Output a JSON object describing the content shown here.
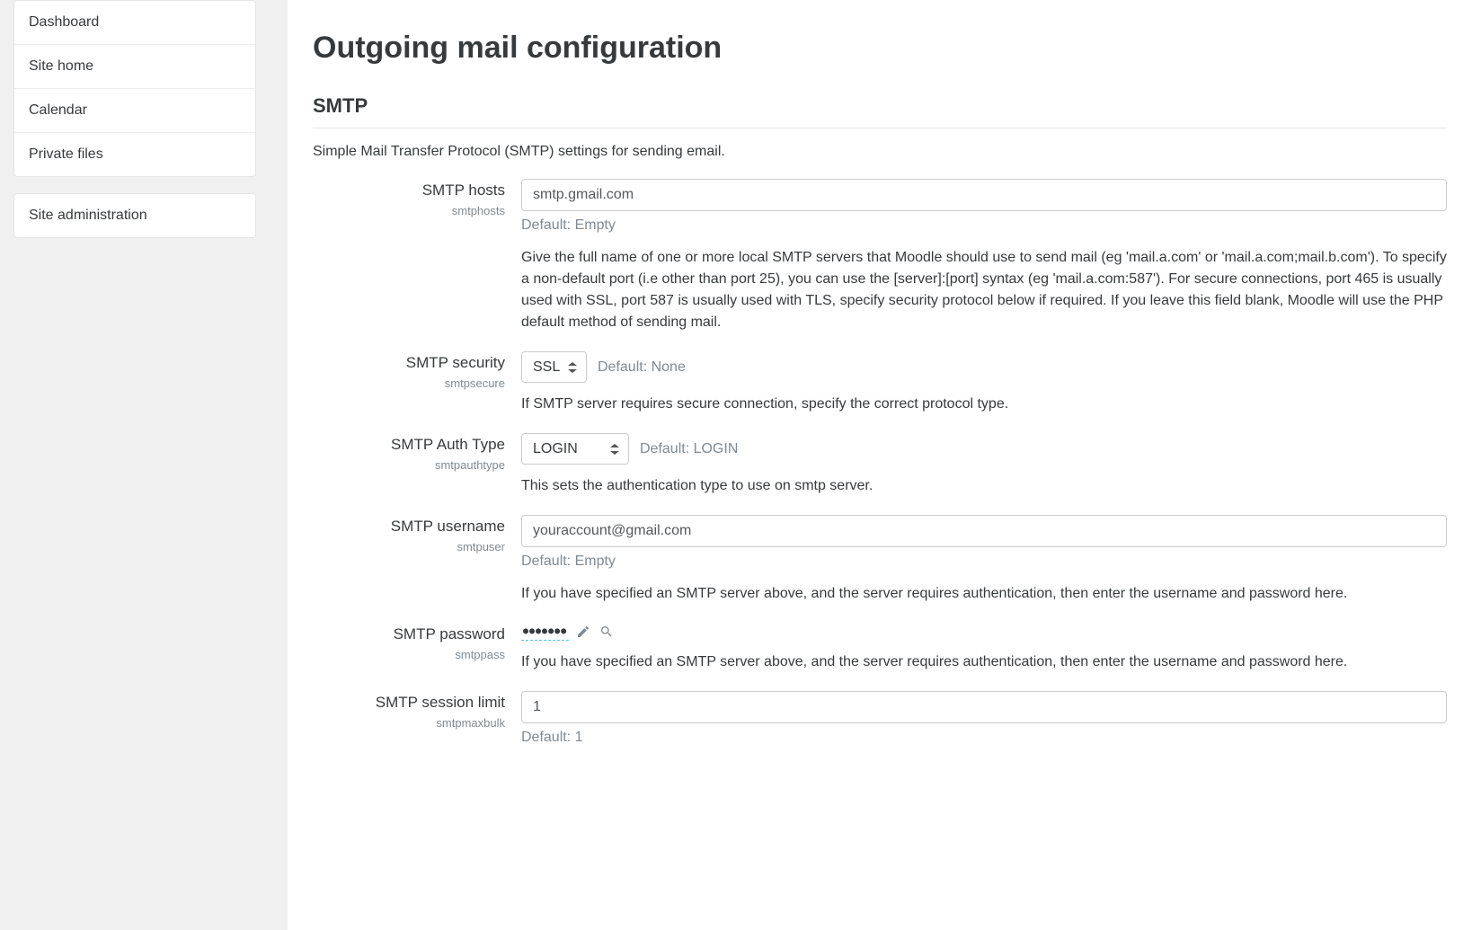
{
  "sidebar": {
    "block1": {
      "items": [
        {
          "label": "Dashboard"
        },
        {
          "label": "Site home"
        },
        {
          "label": "Calendar"
        },
        {
          "label": "Private files"
        }
      ]
    },
    "block2": {
      "items": [
        {
          "label": "Site administration"
        }
      ]
    }
  },
  "main": {
    "title": "Outgoing mail configuration",
    "section": {
      "title": "SMTP",
      "description": "Simple Mail Transfer Protocol (SMTP) settings for sending email.",
      "fields": {
        "smtphosts": {
          "label": "SMTP hosts",
          "name": "smtphosts",
          "value": "smtp.gmail.com",
          "default": "Default: Empty",
          "help": "Give the full name of one or more local SMTP servers that Moodle should use to send mail (eg 'mail.a.com' or 'mail.a.com;mail.b.com'). To specify a non-default port (i.e other than port 25), you can use the [server]:[port] syntax (eg 'mail.a.com:587'). For secure connections, port 465 is usually used with SSL, port 587 is usually used with TLS, specify security protocol below if required. If you leave this field blank, Moodle will use the PHP default method of sending mail."
        },
        "smtpsecure": {
          "label": "SMTP security",
          "name": "smtpsecure",
          "value": "SSL",
          "default": "Default: None",
          "help": "If SMTP server requires secure connection, specify the correct protocol type."
        },
        "smtpauthtype": {
          "label": "SMTP Auth Type",
          "name": "smtpauthtype",
          "value": "LOGIN",
          "default": "Default: LOGIN",
          "help": "This sets the authentication type to use on smtp server."
        },
        "smtpuser": {
          "label": "SMTP username",
          "name": "smtpuser",
          "value": "youraccount@gmail.com",
          "default": "Default: Empty",
          "help": "If you have specified an SMTP server above, and the server requires authentication, then enter the username and password here."
        },
        "smtppass": {
          "label": "SMTP password",
          "name": "smtppass",
          "masked": "●●●●●●●",
          "help": "If you have specified an SMTP server above, and the server requires authentication, then enter the username and password here."
        },
        "smtpmaxbulk": {
          "label": "SMTP session limit",
          "name": "smtpmaxbulk",
          "value": "1",
          "default": "Default: 1"
        }
      }
    }
  }
}
